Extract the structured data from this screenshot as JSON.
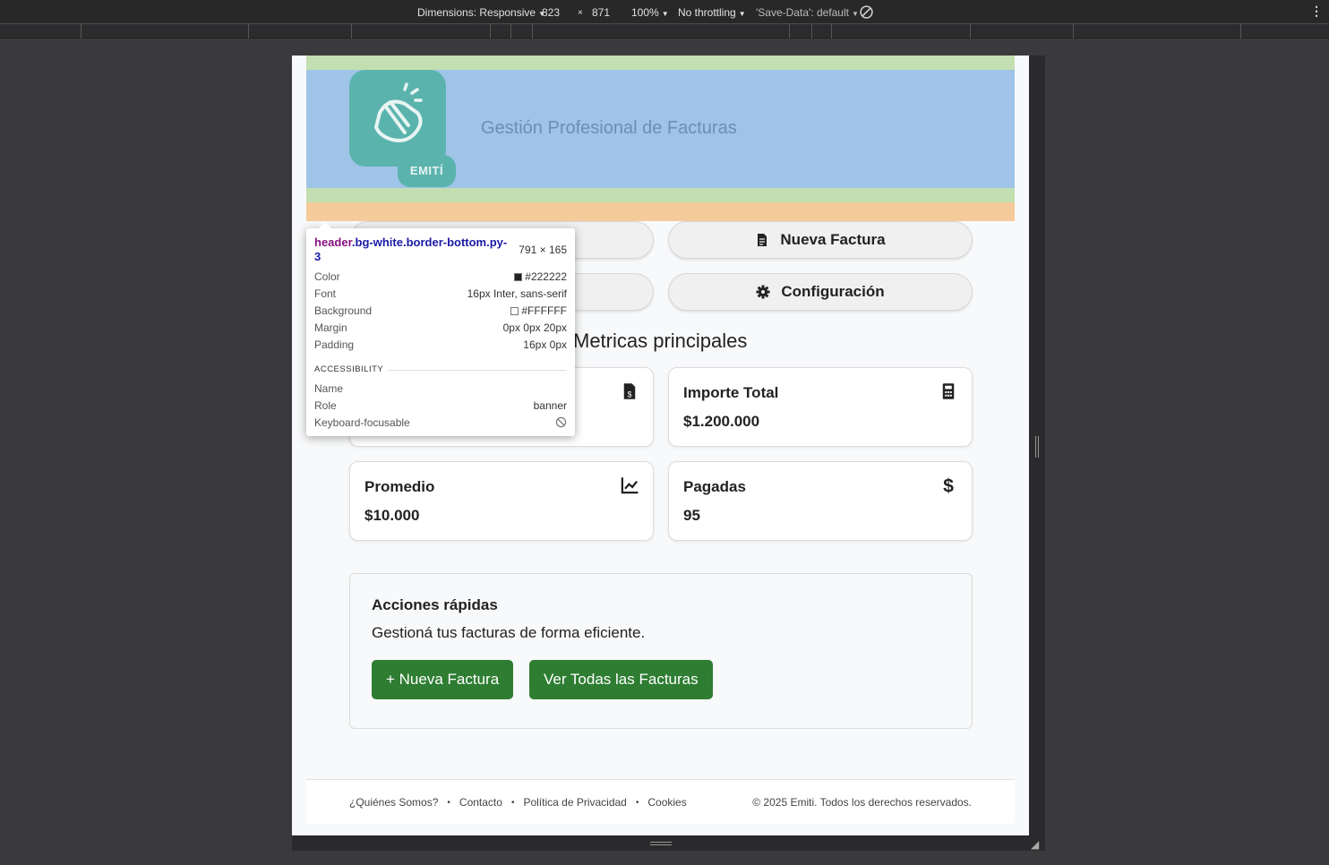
{
  "devtools": {
    "dimensions_label": "Dimensions: Responsive",
    "width": "823",
    "times": "×",
    "height": "871",
    "zoom": "100%",
    "throttling": "No throttling",
    "save_data": "'Save-Data': default"
  },
  "header": {
    "logo_text": "EMITÍ",
    "subtitle": "Gestión Profesional de Facturas"
  },
  "nav_buttons": {
    "new_invoice": "Nueva Factura",
    "settings": "Configuración"
  },
  "metrics": {
    "title": "Metricas principales",
    "cards": [
      {
        "label": "Importe Total",
        "value": "$1.200.000",
        "icon": "calculator-icon"
      },
      {
        "label": "Promedio",
        "value": "$10.000",
        "icon": "chart-line-icon"
      },
      {
        "label": "Pagadas",
        "value": "95",
        "icon": "dollar-icon"
      }
    ]
  },
  "quick_actions": {
    "title": "Acciones rápidas",
    "description": "Gestioná tus facturas de forma eficiente.",
    "new_invoice": "+ Nueva Factura",
    "view_all": "Ver Todas las Facturas",
    "button_color": "#2e7d32"
  },
  "footer": {
    "links": [
      "¿Quiénes Somos?",
      "Contacto",
      "Política de Privacidad",
      "Cookies"
    ],
    "separator": "•",
    "copyright": "© 2025 Emiti. Todos los derechos reservados."
  },
  "inspector": {
    "selector_tag": "header",
    "selector_classes": ".bg-white.border-bottom.py-3",
    "size": "791 × 165",
    "rows": [
      {
        "key": "Color",
        "value": "#222222",
        "swatch": "#222222"
      },
      {
        "key": "Font",
        "value": "16px Inter, sans-serif"
      },
      {
        "key": "Background",
        "value": "#FFFFFF",
        "swatch": "#FFFFFF"
      },
      {
        "key": "Margin",
        "value": "0px 0px 20px"
      },
      {
        "key": "Padding",
        "value": "16px 0px"
      }
    ],
    "accessibility_title": "ACCESSIBILITY",
    "acc_rows": [
      {
        "key": "Name",
        "value": ""
      },
      {
        "key": "Role",
        "value": "banner"
      },
      {
        "key": "Keyboard-focusable",
        "value": ""
      }
    ]
  }
}
